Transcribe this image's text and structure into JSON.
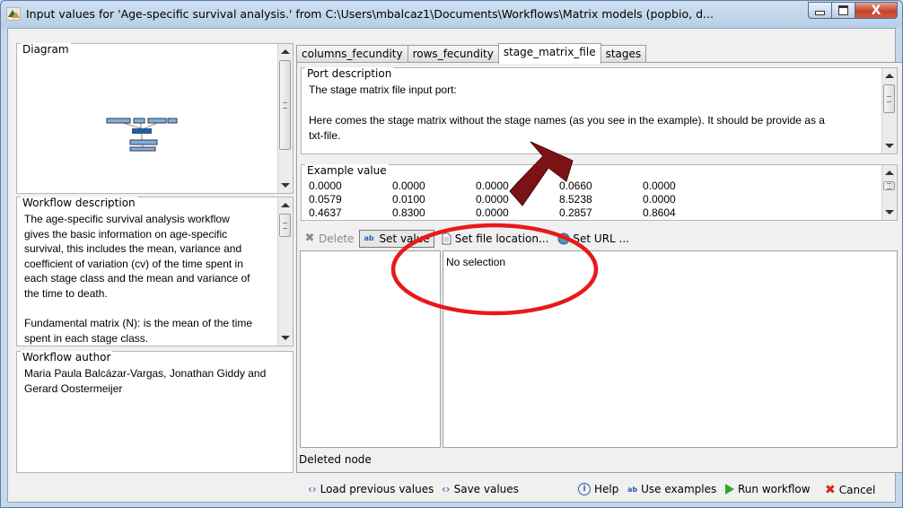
{
  "window": {
    "title": "Input values for 'Age-specific survival analysis.' from C:\\Users\\mbalcaz1\\Documents\\Workflows\\Matrix models (popbio, d...",
    "minimize_icon": "minimize-icon",
    "maximize_icon": "maximize-icon",
    "close_label": "X"
  },
  "left_panel": {
    "diagram": {
      "legend": "Diagram",
      "thumbnail_icon": "workflow-diagram-thumbnail"
    },
    "workflow_description": {
      "legend": "Workflow description",
      "lines": [
        "The age-specific survival analysis workflow",
        "gives the basic information on age-specific",
        "survival, this includes the mean, variance and",
        "coefficient of variation (cv) of the time spent in",
        "each stage class and the mean and variance of",
        "the time to death.",
        "",
        "Fundamental matrix (N): is the mean of the time",
        "spent in each stage class."
      ]
    },
    "workflow_author": {
      "legend": "Workflow author",
      "lines": [
        "Maria Paula Balcázar-Vargas, Jonathan Giddy and",
        "Gerard Oostermeijer"
      ]
    }
  },
  "tabs": [
    {
      "label": "columns_fecundity",
      "active": false
    },
    {
      "label": "rows_fecundity",
      "active": false
    },
    {
      "label": "stage_matrix_file",
      "active": true
    },
    {
      "label": "stages",
      "active": false
    }
  ],
  "port_description": {
    "legend": "Port description",
    "lines": [
      "The stage matrix file input port:",
      "",
      "Here comes the stage matrix without the stage names (as you see in the example).  It should be provide as a",
      "txt-file."
    ]
  },
  "example_value": {
    "legend": "Example value",
    "rows": [
      [
        "0.0000",
        "0.0000",
        "0.0000",
        "0.0660",
        "0.0000"
      ],
      [
        "0.0579",
        "0.0100",
        "0.0000",
        "8.5238",
        "0.0000"
      ],
      [
        "0.4637",
        "0.8300",
        "0.0000",
        "0.2857",
        "0.8604"
      ]
    ]
  },
  "toolbar": {
    "delete": {
      "label": "Delete",
      "icon": "delete-x-icon"
    },
    "set_value": {
      "label": "Set value",
      "icon": "text-value-icon"
    },
    "set_file_location": {
      "label": "Set file location...",
      "icon": "file-icon"
    },
    "set_url": {
      "label": "Set URL ...",
      "icon": "globe-icon"
    }
  },
  "detail": {
    "text": "No selection"
  },
  "status": {
    "text": "Deleted node"
  },
  "bottom": {
    "load_previous": {
      "label": "Load previous values",
      "icon": "arrows-icon"
    },
    "save_values": {
      "label": "Save values",
      "icon": "arrows-icon"
    },
    "help": {
      "label": "Help",
      "icon": "info-icon"
    },
    "use_examples": {
      "label": "Use examples",
      "icon": "text-value-icon"
    },
    "run_workflow": {
      "label": "Run workflow",
      "icon": "play-icon"
    },
    "cancel": {
      "label": "Cancel",
      "icon": "cancel-x-icon"
    }
  },
  "colors": {
    "annotation_red": "#e8191a",
    "annotation_arrow": "#7b1216",
    "run_green": "#2fa52f",
    "cancel_red": "#d8261e"
  }
}
